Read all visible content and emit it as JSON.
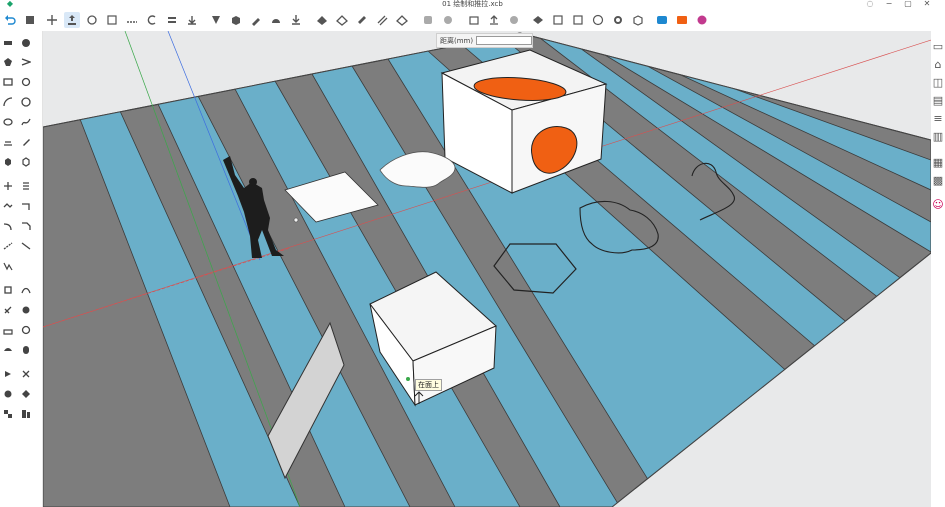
{
  "window": {
    "title": "01 绘制和推拉.xcb"
  },
  "colors": {
    "blue_strip": "#6aafc9",
    "gray_strip": "#7d7d7d",
    "orange": "#f06013",
    "accent": "#1e88d0"
  },
  "toolbar": {
    "icons": [
      "undo-icon",
      "menu-icon",
      "select-icon",
      "push-pull-icon",
      "move-icon",
      "rotate-icon",
      "scale-icon",
      "tape-icon",
      "offset-icon",
      "paint-icon",
      "follow-me-icon",
      "component-icon",
      "material-icon",
      "section-icon",
      "text-icon",
      "dimension-icon",
      "axes-icon",
      "union-icon",
      "subtract-icon",
      "intersect-icon",
      "trim-icon",
      "split-icon",
      "group-icon",
      "ungroup-icon",
      "import-icon",
      "export-icon",
      "share-icon",
      "view-icon",
      "layers-icon",
      "help-icon",
      "settings-icon",
      "cube-icon",
      "camera-icon",
      "render-icon",
      "plugin-icon"
    ]
  },
  "measurement": {
    "label": "距离(mm)",
    "value": ""
  },
  "tooltip": {
    "text": "在面上"
  }
}
